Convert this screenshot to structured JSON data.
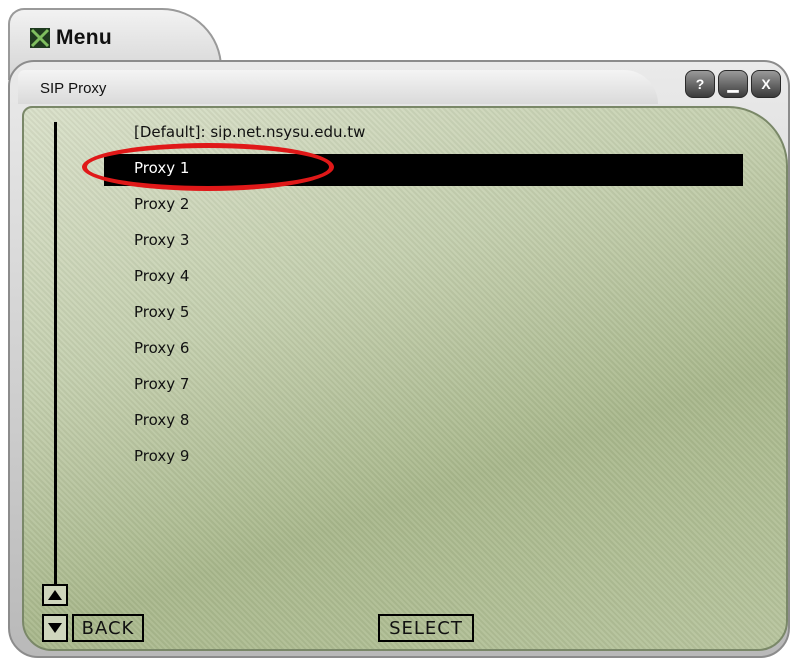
{
  "menu_tab": {
    "title": "Menu",
    "icon": "menu-app-icon"
  },
  "window": {
    "title": "SIP Proxy",
    "buttons": [
      {
        "label": "?",
        "icon": "help-icon"
      },
      {
        "label": "▁",
        "icon": "minimize-icon"
      },
      {
        "label": "X",
        "icon": "close-icon"
      }
    ]
  },
  "list": {
    "items": [
      {
        "label": "[Default]: sip.net.nsysu.edu.tw",
        "selected": false
      },
      {
        "label": "Proxy 1",
        "selected": true
      },
      {
        "label": "Proxy 2",
        "selected": false
      },
      {
        "label": "Proxy 3",
        "selected": false
      },
      {
        "label": "Proxy 4",
        "selected": false
      },
      {
        "label": "Proxy 5",
        "selected": false
      },
      {
        "label": "Proxy 6",
        "selected": false
      },
      {
        "label": "Proxy 7",
        "selected": false
      },
      {
        "label": "Proxy 8",
        "selected": false
      },
      {
        "label": "Proxy 9",
        "selected": false
      }
    ]
  },
  "softkeys": {
    "back": "BACK",
    "select": "SELECT"
  },
  "colors": {
    "highlight": "#000000",
    "annotation": "#e01818",
    "panel": "#c4cfae"
  }
}
